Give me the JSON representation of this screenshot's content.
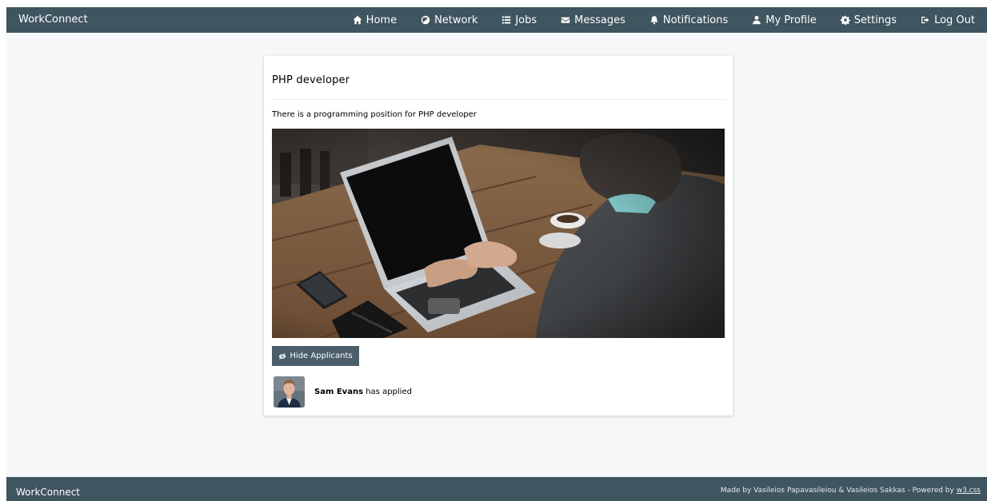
{
  "navbar": {
    "brand": "WorkConnect",
    "items": [
      {
        "label": "Home",
        "icon": "home-icon"
      },
      {
        "label": "Network",
        "icon": "globe-icon"
      },
      {
        "label": "Jobs",
        "icon": "list-icon"
      },
      {
        "label": "Messages",
        "icon": "envelope-icon"
      },
      {
        "label": "Notifications",
        "icon": "bell-icon"
      },
      {
        "label": "My Profile",
        "icon": "user-icon"
      },
      {
        "label": "Settings",
        "icon": "gear-icon"
      },
      {
        "label": "Log Out",
        "icon": "sign-out-icon"
      }
    ]
  },
  "job": {
    "title": "PHP developer",
    "description": "There is a programming position for PHP developer",
    "hide_button_label": "Hide Applicants",
    "hide_button_icon": "eye-slash-icon",
    "applicants": [
      {
        "name": "Sam Evans",
        "status": "has applied"
      }
    ]
  },
  "footer": {
    "brand": "WorkConnect",
    "credit": "Made by Vasileios Papavasileiou & Vasileios Sakkas - Powered by",
    "link": "w3.css"
  },
  "colors": {
    "bar": "#3f555f",
    "page_background": "#f5f7f8",
    "button": "#4a5f69"
  }
}
